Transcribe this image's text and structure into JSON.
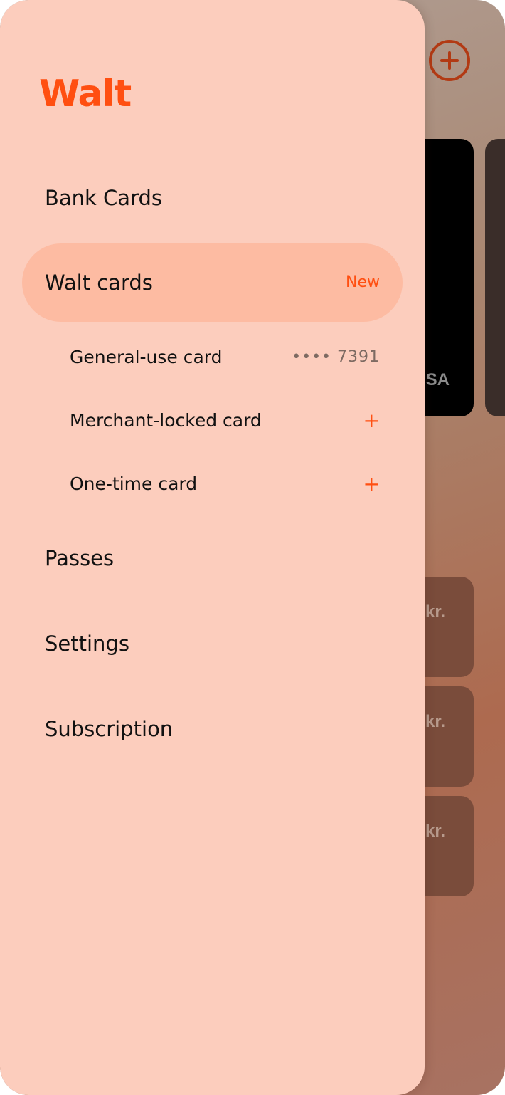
{
  "background": {
    "card_brand_fragment": "SA",
    "tile_amounts": [
      "kr.",
      "kr.",
      "kr."
    ]
  },
  "drawer": {
    "logo": "Walt",
    "items": {
      "bank_cards": "Bank Cards",
      "walt_cards": {
        "label": "Walt cards",
        "badge": "New"
      },
      "passes": "Passes",
      "settings": "Settings",
      "subscription": "Subscription"
    },
    "walt_card_types": [
      {
        "label": "General-use card",
        "meta": "•••• 7391"
      },
      {
        "label": "Merchant-locked card",
        "action": "+"
      },
      {
        "label": "One-time card",
        "action": "+"
      }
    ]
  },
  "colors": {
    "accent": "#ff4f11",
    "drawer_bg": "#fccdbd",
    "active_pill": "#fdbba2"
  }
}
